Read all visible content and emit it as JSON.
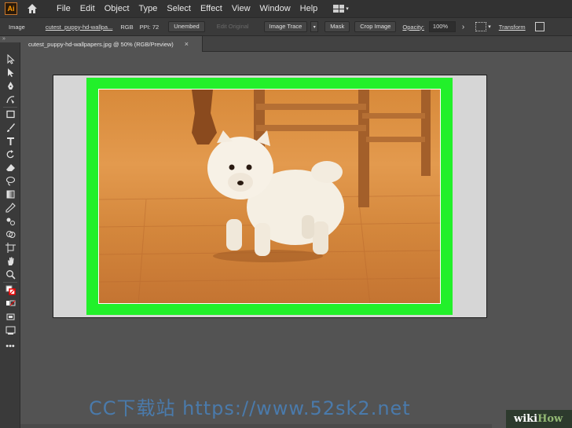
{
  "app": {
    "logo_text": "Ai"
  },
  "menu": [
    "File",
    "Edit",
    "Object",
    "Type",
    "Select",
    "Effect",
    "View",
    "Window",
    "Help"
  ],
  "control_bar": {
    "label": "Image",
    "filename": "cutest_puppy-hd-wallpa...",
    "mode": "RGB",
    "ppi": "PPI: 72",
    "unembed": "Unembed",
    "edit_original": "Edit Original",
    "image_trace": "Image Trace",
    "mask": "Mask",
    "crop_image": "Crop Image",
    "opacity_label": "Opacity:",
    "opacity_value": "100%",
    "transform": "Transform"
  },
  "tab": {
    "title": "cutest_puppy-hd-wallpapers.jpg @ 50% (RGB/Preview)",
    "close": "×"
  },
  "panel_collapse": "»",
  "tools": [
    "selection-icon",
    "direct-selection-icon",
    "pen-icon",
    "curvature-icon",
    "rectangle-icon",
    "paintbrush-icon",
    "type-icon",
    "rotate-icon",
    "eraser-icon",
    "lasso-icon",
    "gradient-icon",
    "eyedropper-icon",
    "blend-icon",
    "shape-builder-icon",
    "artboard-icon",
    "hand-icon",
    "zoom-icon",
    "fill-stroke-icon",
    "drawing-mode-icon",
    "screen-mode-icon",
    "more-tools-icon"
  ],
  "colors": {
    "selection_highlight": "#22f02a",
    "accent": "#ff9a00"
  },
  "watermark": "CC下载站 https://www.52sk2.net",
  "wiki": {
    "a": "wiki",
    "b": "How"
  }
}
